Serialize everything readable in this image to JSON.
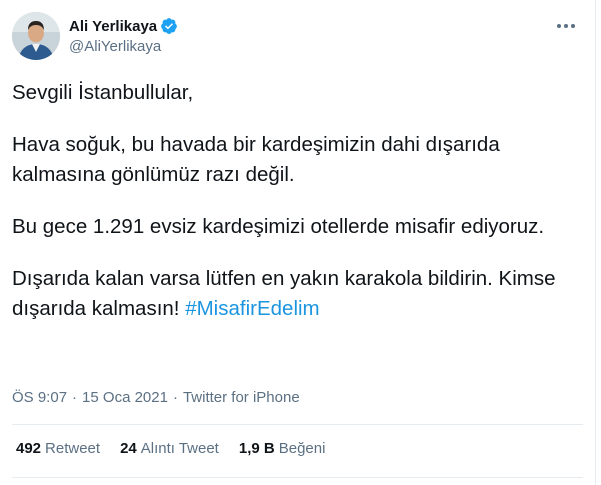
{
  "author": {
    "display_name": "Ali Yerlikaya",
    "handle": "@AliYerlikaya",
    "verified_icon": "verified-badge-icon",
    "verified_color": "#1da1f2"
  },
  "tweet": {
    "paragraphs": [
      "Sevgili İstanbullular,",
      "Hava soğuk, bu havada bir kardeşimizin dahi dışarıda kalmasına gönlümüz razı değil.",
      "Bu gece 1.291 evsiz kardeşimizi otellerde misafir ediyoruz."
    ],
    "last_paragraph_text": "Dışarıda kalan varsa lütfen en yakın karakola bildirin. Kimse dışarıda kalmasın! ",
    "hashtag": "#MisafirEdelim",
    "hashtag_color": "#1b95e0"
  },
  "meta": {
    "time": "ÖS 9:07",
    "separator": "·",
    "date": "15 Oca 2021",
    "source": "Twitter for iPhone"
  },
  "stats": {
    "retweets": {
      "count": "492",
      "label": "Retweet"
    },
    "quotes": {
      "count": "24",
      "label": "Alıntı Tweet"
    },
    "likes": {
      "count": "1,9 B",
      "label": "Beğeni"
    }
  },
  "menu": {
    "more_icon": "more-options-icon"
  }
}
